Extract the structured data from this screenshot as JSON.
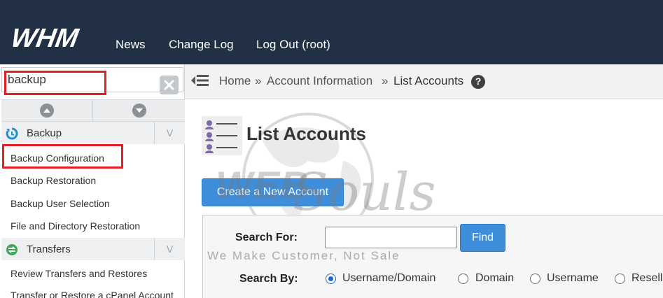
{
  "header": {
    "logo_text": "WHM",
    "nav": [
      "News",
      "Change Log",
      "Log Out (root)"
    ]
  },
  "sidebar": {
    "search_value": "backup",
    "groups": [
      {
        "label": "Backup",
        "icon": "backup-icon",
        "items": [
          "Backup Configuration",
          "Backup Restoration",
          "Backup User Selection",
          "File and Directory Restoration"
        ]
      },
      {
        "label": "Transfers",
        "icon": "transfers-icon",
        "items": [
          "Review Transfers and Restores",
          "Transfer or Restore a cPanel Account"
        ]
      }
    ],
    "caret": "V"
  },
  "breadcrumb": {
    "items": [
      "Home",
      "Account Information",
      "List Accounts"
    ],
    "separator": "»"
  },
  "main": {
    "title": "List Accounts",
    "create_button": "Create a New Account",
    "search_for_label": "Search For:",
    "search_value": "",
    "find_button": "Find",
    "search_by_label": "Search By:",
    "search_by_options": [
      "Username/Domain",
      "Domain",
      "Username",
      "Reseller"
    ],
    "selected_option": "Username/Domain"
  },
  "watermark": {
    "text1": "WEB",
    "text2": "Souls",
    "tagline": "We Make Customer, Not Sale"
  },
  "colors": {
    "topbar": "#213045",
    "highlight_red": "#e31e24",
    "primary_button": "#3f8edb",
    "backup_icon": "#1f8fd6",
    "transfers_icon": "#3aa656"
  }
}
